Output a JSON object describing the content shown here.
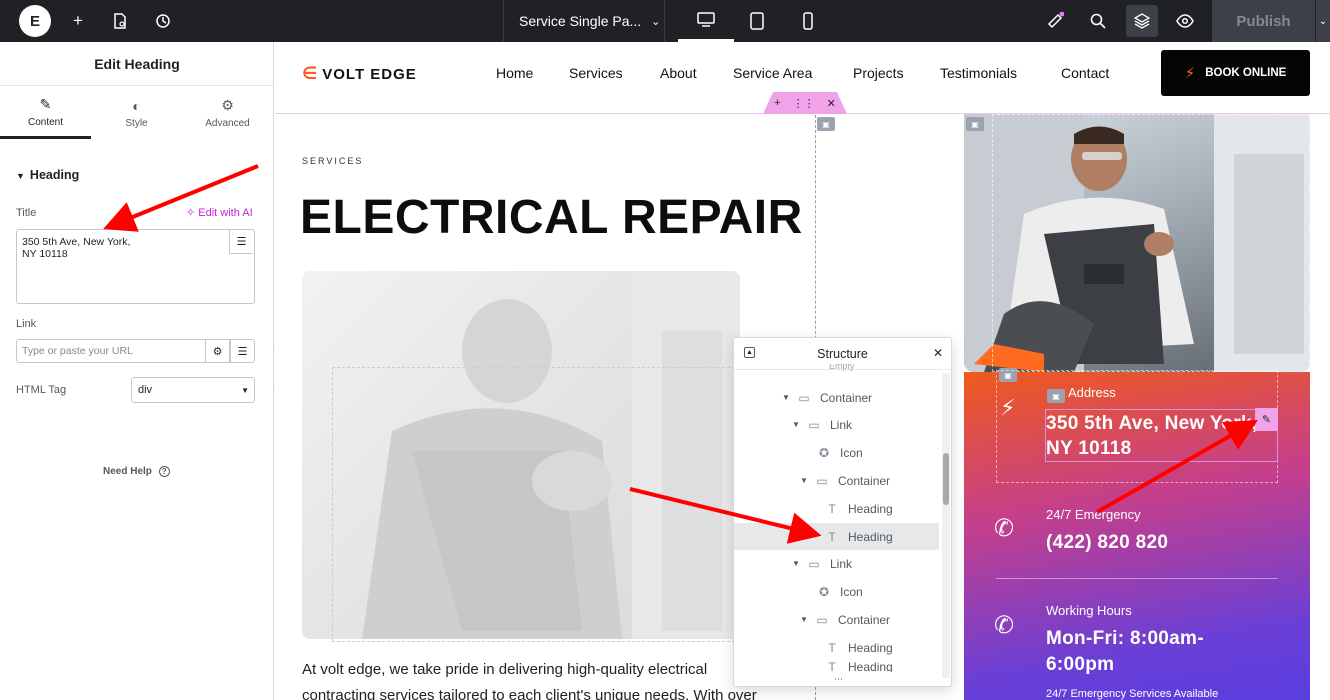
{
  "topbar": {
    "logo": "E",
    "page_name": "Service Single Pa...",
    "publish_label": "Publish"
  },
  "panel": {
    "title": "Edit Heading",
    "tabs": [
      {
        "label": "Content",
        "icon": "pencil-icon"
      },
      {
        "label": "Style",
        "icon": "half-circle-icon"
      },
      {
        "label": "Advanced",
        "icon": "gear-icon"
      }
    ],
    "section": "Heading",
    "title_label": "Title",
    "edit_ai_label": "Edit with AI",
    "title_value": "350 5th Ave, New York,\nNY 10118",
    "link_label": "Link",
    "link_placeholder": "Type or paste your URL",
    "html_tag_label": "HTML Tag",
    "html_tag_value": "div",
    "need_help": "Need Help"
  },
  "site": {
    "brand": "VOLT EDGE",
    "nav": [
      "Home",
      "Services",
      "About",
      "Service Area",
      "Projects",
      "Testimonials",
      "Contact"
    ],
    "book_label": "BOOK ONLINE",
    "eyebrow": "SERVICES",
    "hero_title": "ELECTRICAL REPAIR",
    "body_line1": "At volt edge, we take pride in delivering high-quality electrical",
    "body_line2": "contracting services tailored to each client's unique needs. With over",
    "card": {
      "address_label": "Address",
      "address_value": "350 5th Ave, New York, NY 10118",
      "emergency_label": "24/7 Emergency",
      "emergency_value": "(422) 820 820",
      "hours_label": "Working Hours",
      "hours_value_line1": "Mon-Fri: 8:00am-",
      "hours_value_line2": "6:00pm",
      "footer_note": "24/7 Emergency Services Available"
    }
  },
  "structure": {
    "title": "Structure",
    "cut_off_top": "Empty",
    "items": [
      {
        "label": "Container",
        "type": "container"
      },
      {
        "label": "Link",
        "type": "link"
      },
      {
        "label": "Icon",
        "type": "icon"
      },
      {
        "label": "Container",
        "type": "container"
      },
      {
        "label": "Heading",
        "type": "heading"
      },
      {
        "label": "Heading",
        "type": "heading",
        "selected": true
      },
      {
        "label": "Link",
        "type": "link"
      },
      {
        "label": "Icon",
        "type": "icon"
      },
      {
        "label": "Container",
        "type": "container"
      },
      {
        "label": "Heading",
        "type": "heading"
      },
      {
        "label": "Heading",
        "type": "heading"
      }
    ]
  },
  "colors": {
    "accent_orange": "#ff5a1f",
    "editor_dark": "#1f2124",
    "selection_pink": "#f0a3e8",
    "ai_magenta": "#c026d3",
    "annotation_red": "#ff0000"
  }
}
